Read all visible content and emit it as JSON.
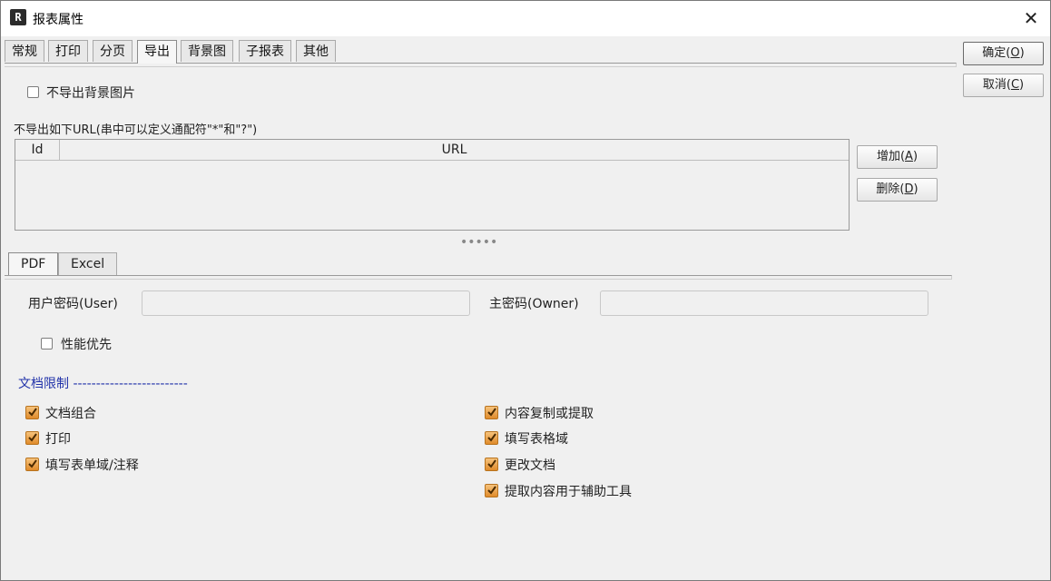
{
  "window": {
    "title": "报表属性",
    "icon": "report-icon",
    "close_icon": "close-icon"
  },
  "tabs": [
    {
      "label": "常规"
    },
    {
      "label": "打印"
    },
    {
      "label": "分页"
    },
    {
      "label": "导出",
      "active": true
    },
    {
      "label": "背景图"
    },
    {
      "label": "子报表"
    },
    {
      "label": "其他"
    }
  ],
  "buttons": {
    "ok": {
      "text": "确定(",
      "key": "O",
      "end": ")"
    },
    "cancel": {
      "text": "取消(",
      "key": "C",
      "end": ")"
    },
    "add": {
      "text": "增加(",
      "key": "A",
      "end": ")"
    },
    "delete": {
      "text": "删除(",
      "key": "D",
      "end": ")"
    }
  },
  "export": {
    "no_background_label": "不导出背景图片",
    "no_background_checked": false,
    "url_section_label": "不导出如下URL(串中可以定义通配符\"*\"和\"?\")",
    "table": {
      "columns": [
        "Id",
        "URL"
      ],
      "rows": []
    },
    "splitter": "•••••"
  },
  "sub_tabs": [
    {
      "label": "PDF",
      "active": true
    },
    {
      "label": "Excel"
    }
  ],
  "pdf": {
    "user_password_label": "用户密码(User)",
    "user_password_value": "",
    "owner_password_label": "主密码(Owner)",
    "owner_password_value": "",
    "performance_first_label": "性能优先",
    "performance_first_checked": false,
    "restrictions_title": "文档限制 -------------------------",
    "restrictions_left": [
      {
        "label": "文档组合",
        "checked": true
      },
      {
        "label": "打印",
        "checked": true
      },
      {
        "label": "填写表单域/注释",
        "checked": true
      }
    ],
    "restrictions_right": [
      {
        "label": "内容复制或提取",
        "checked": true
      },
      {
        "label": "填写表格域",
        "checked": true
      },
      {
        "label": "更改文档",
        "checked": true
      },
      {
        "label": "提取内容用于辅助工具",
        "checked": true
      }
    ]
  },
  "colors": {
    "accent_checkbox": "#e8952f",
    "section_title": "#2233aa"
  }
}
